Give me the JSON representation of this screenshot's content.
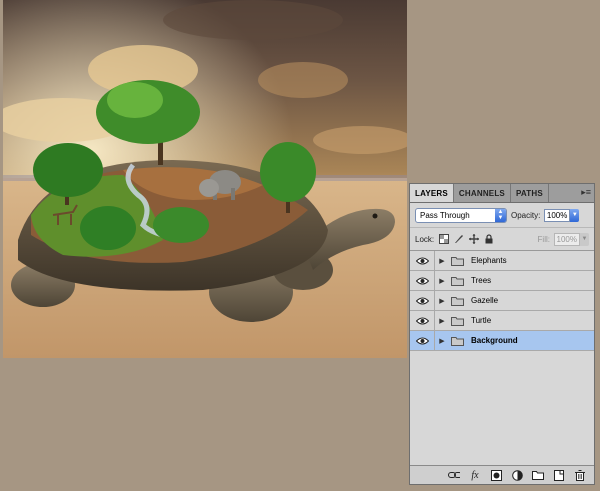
{
  "panel": {
    "tabs": [
      {
        "label": "LAYERS",
        "active": true
      },
      {
        "label": "CHANNELS",
        "active": false
      },
      {
        "label": "PATHS",
        "active": false
      }
    ],
    "menu_icon": "panel-menu-icon",
    "blend_mode": "Pass Through",
    "opacity_label": "Opacity:",
    "opacity_value": "100%",
    "lock_label": "Lock:",
    "fill_label": "Fill:",
    "fill_value": "100%",
    "layers": [
      {
        "name": "Elephants",
        "type": "group",
        "visible": true,
        "selected": false
      },
      {
        "name": "Trees",
        "type": "group",
        "visible": true,
        "selected": false
      },
      {
        "name": "Gazelle",
        "type": "group",
        "visible": true,
        "selected": false
      },
      {
        "name": "Turtle",
        "type": "group",
        "visible": true,
        "selected": false
      },
      {
        "name": "Background",
        "type": "group",
        "visible": true,
        "selected": true
      }
    ],
    "bottom_icons": [
      "link-icon",
      "fx-icon",
      "mask-icon",
      "adjustment-icon",
      "new-group-icon",
      "new-layer-icon",
      "trash-icon"
    ],
    "fx_label": "fx"
  },
  "colors": {
    "panel_bg": "#d7d7d7",
    "selected_row": "#a7c6ef",
    "workspace_bg": "#a69683"
  }
}
